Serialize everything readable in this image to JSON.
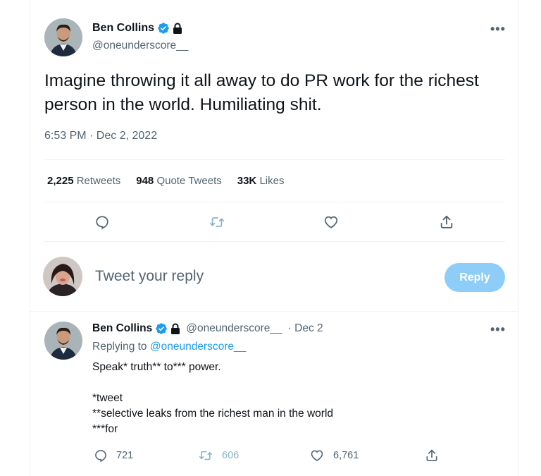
{
  "tweet": {
    "author_name": "Ben Collins",
    "author_handle": "@oneunderscore__",
    "text": "Imagine throwing it all away to do PR work for the richest person in the world. Humiliating shit.",
    "timestamp": "6:53 PM · Dec 2, 2022",
    "stats": {
      "retweets_count": "2,225",
      "retweets_label": "Retweets",
      "quotes_count": "948",
      "quotes_label": "Quote Tweets",
      "likes_count": "33K",
      "likes_label": "Likes"
    },
    "more_label": "•••"
  },
  "composer": {
    "placeholder": "Tweet your reply",
    "button_label": "Reply"
  },
  "reply": {
    "author_name": "Ben Collins",
    "author_handle": "@oneunderscore__",
    "date": "· Dec 2",
    "replying_prefix": "Replying to",
    "replying_to": "@oneunderscore__",
    "text": "Speak* truth** to*** power.\n\n*tweet\n**selective leaks from the richest man in the world\n***for",
    "replies": "721",
    "retweets": "606",
    "likes": "6,761",
    "more_label": "•••"
  },
  "colors": {
    "accent": "#1d9bf0",
    "reply_button": "#8ecdf8",
    "muted_text": "#536471",
    "divider": "#eff3f4"
  }
}
